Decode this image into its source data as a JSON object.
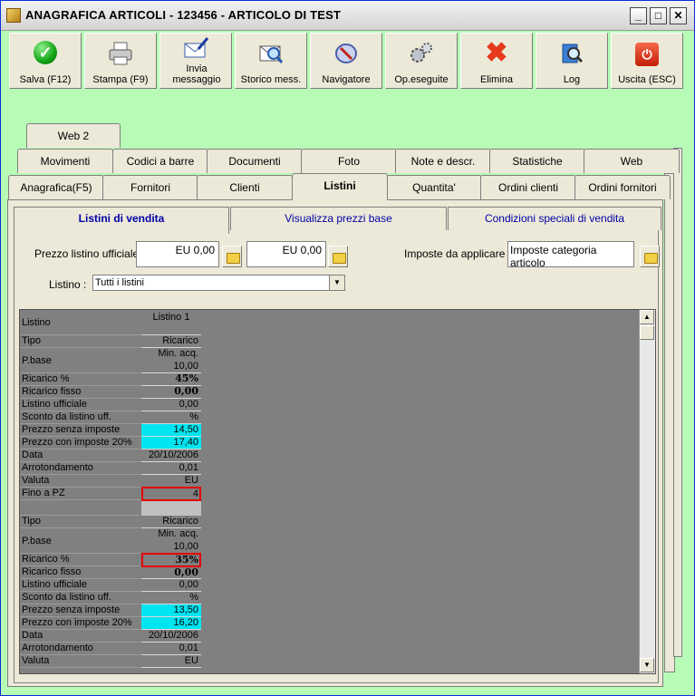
{
  "window": {
    "title": "ANAGRAFICA ARTICOLI - 123456 - ARTICOLO DI TEST"
  },
  "toolbar": {
    "buttons": [
      {
        "label": "Salva (F12)",
        "icon": "check-icon"
      },
      {
        "label": "Stampa (F9)",
        "icon": "printer-icon"
      },
      {
        "label": "Invia messaggio",
        "icon": "envelope-pen-icon"
      },
      {
        "label": "Storico mess.",
        "icon": "mail-search-icon"
      },
      {
        "label": "Navigatore",
        "icon": "navigator-icon"
      },
      {
        "label": "Op.eseguite",
        "icon": "gears-icon"
      },
      {
        "label": "Elimina",
        "icon": "delete-x-icon"
      },
      {
        "label": "Log",
        "icon": "log-search-icon"
      },
      {
        "label": "Uscita (ESC)",
        "icon": "exit-icon"
      }
    ]
  },
  "tabs": {
    "row3": [
      "Web 2"
    ],
    "row2": [
      "Movimenti",
      "Codici a barre",
      "Documenti",
      "Foto",
      "Note e descr.",
      "Statistiche",
      "Web"
    ],
    "row1": [
      "Anagrafica(F5)",
      "Fornitori",
      "Clienti",
      "Listini",
      "Quantita'",
      "Ordini clienti",
      "Ordini fornitori"
    ],
    "active": "Listini"
  },
  "subtabs": [
    "Listini di vendita",
    "Visualizza prezzi base",
    "Condizioni speciali di vendita"
  ],
  "form": {
    "prezzo_label": "Prezzo listino ufficiale :",
    "prezzo1": "EU 0,00",
    "prezzo2": "EU 0,00",
    "imposte_label": "Imposte da applicare :",
    "imposte_value": "Imposte categoria articolo",
    "listino_label": "Listino :",
    "listino_value": "Tutti i listini"
  },
  "grid": {
    "header_label": "Listino",
    "column": "Listino 1",
    "block1": [
      {
        "label": "Tipo",
        "value": "Ricarico"
      },
      {
        "label": "P.base",
        "value": "Min. acq.",
        "value2": "10,00"
      },
      {
        "label": "Ricarico %",
        "value": "45%"
      },
      {
        "label": "Ricarico fisso",
        "value": "0,00"
      },
      {
        "label": "Listino ufficiale",
        "value": "0,00"
      },
      {
        "label": "Sconto da listino uff.",
        "value": "%"
      },
      {
        "label": "Prezzo senza imposte",
        "value": "14,50"
      },
      {
        "label": "Prezzo con imposte 20%",
        "value": "17,40"
      },
      {
        "label": "Data",
        "value": "20/10/2006"
      },
      {
        "label": "Arrotondamento",
        "value": "0,01"
      },
      {
        "label": "Valuta",
        "value": "EU"
      },
      {
        "label": "Fino a PZ",
        "value": "4"
      }
    ],
    "block2": [
      {
        "label": "Tipo",
        "value": "Ricarico"
      },
      {
        "label": "P.base",
        "value": "Min. acq.",
        "value2": "10,00"
      },
      {
        "label": "Ricarico %",
        "value": "35%"
      },
      {
        "label": "Ricarico fisso",
        "value": "0,00"
      },
      {
        "label": "Listino ufficiale",
        "value": "0,00"
      },
      {
        "label": "Sconto da listino uff.",
        "value": "%"
      },
      {
        "label": "Prezzo senza imposte",
        "value": "13,50"
      },
      {
        "label": "Prezzo con imposte 20%",
        "value": "16,20"
      },
      {
        "label": "Data",
        "value": "20/10/2006"
      },
      {
        "label": "Arrotondamento",
        "value": "0,01"
      },
      {
        "label": "Valuta",
        "value": "EU"
      }
    ]
  }
}
